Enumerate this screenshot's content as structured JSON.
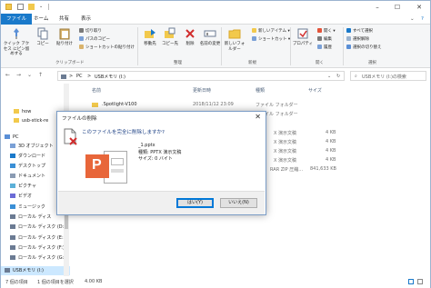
{
  "colors": {
    "accent": "#1979ca",
    "folder": "#f2c94c",
    "ppt": "#e8663a",
    "selection": "#cce8ff"
  },
  "titlebar": {
    "title": ""
  },
  "tabs": [
    "ファイル",
    "ホーム",
    "共有",
    "表示"
  ],
  "ribbon": {
    "pin_label": "クイック アクセス にピン留めする",
    "copy_label": "コピー",
    "paste_label": "貼り付け",
    "cut_label": "切り取り",
    "copy_path_label": "パスのコピー",
    "paste_shortcut_label": "ショートカットの貼り付け",
    "clipboard_group": "クリップボード",
    "move_to_label": "移動先",
    "copy_to_label": "コピー先",
    "delete_label": "削除",
    "rename_label": "名前の変更",
    "organize_group": "整理",
    "new_folder_label": "新しいフォルダー",
    "new_item_label": "新しいアイテム ▾",
    "shortcut_label": "ショートカット ▾",
    "new_group": "新規",
    "properties_label": "プロパティ",
    "open_label": "開く ▾",
    "edit_label": "編集",
    "history_label": "履歴",
    "open_group": "開く",
    "select_all_label": "すべて選択",
    "select_none_label": "選択解除",
    "invert_label": "選択の切り替え",
    "select_group": "選択"
  },
  "address": {
    "pc": "PC",
    "sep": ">",
    "drive": "USBメモリ (I:)",
    "search_placeholder": "USBメモリ (I:)の検索"
  },
  "nav_items": [
    {
      "label": "how",
      "kind": "folder"
    },
    {
      "label": "usb-stick-re",
      "kind": "folder"
    },
    {
      "label": "PC",
      "kind": "pc"
    },
    {
      "label": "3D オブジェクト",
      "kind": "obj3d"
    },
    {
      "label": "ダウンロード",
      "kind": "download"
    },
    {
      "label": "デスクトップ",
      "kind": "desktop"
    },
    {
      "label": "ドキュメント",
      "kind": "doc"
    },
    {
      "label": "ピクチャ",
      "kind": "picture"
    },
    {
      "label": "ビデオ",
      "kind": "video"
    },
    {
      "label": "ミュージック",
      "kind": "music"
    },
    {
      "label": "ローカル ディス",
      "kind": "drive"
    },
    {
      "label": "ローカル ディスク (D:)",
      "kind": "drive"
    },
    {
      "label": "ローカル ディスク (E:)",
      "kind": "drive"
    },
    {
      "label": "ローカル ディスク (F:)",
      "kind": "drive"
    },
    {
      "label": "ローカル ディスク (G:)",
      "kind": "drive"
    },
    {
      "label": "USBメモリ (I:)",
      "kind": "usb"
    }
  ],
  "columns": {
    "name": "名前",
    "date": "更新日時",
    "type": "種類",
    "size": "サイズ"
  },
  "rows": [
    {
      "name": ".Spotlight-V100",
      "date": "2018/11/12 23:09",
      "type": "ファイル フォルダー",
      "size": ""
    },
    {
      "name": "",
      "date": "",
      "type": "ファイル フォルダー",
      "size": ""
    },
    {
      "name": "",
      "date": "",
      "type": "X 演示文稿",
      "size": "4 KB"
    },
    {
      "name": "",
      "date": "",
      "type": "X 演示文稿",
      "size": "4 KB"
    },
    {
      "name": "",
      "date": "",
      "type": "X 演示文稿",
      "size": "4 KB"
    },
    {
      "name": "",
      "date": "",
      "type": "X 演示文稿",
      "size": "4 KB"
    },
    {
      "name": "",
      "date": "",
      "type": "RAR ZIP 圧縮...",
      "size": "841,633 KB"
    }
  ],
  "status": {
    "count": "7 個の項目",
    "selected": "1 個の項目を選択",
    "size": "4.00 KB"
  },
  "dialog": {
    "title": "ファイルの削除",
    "question": "このファイルを完全に削除しますか?",
    "filename": "_1.pptx",
    "filetype": "種類: PPTX 演示文稿",
    "filesize": "サイズ: 0 バイト",
    "yes": "はい(Y)",
    "no": "いいえ(N)"
  }
}
